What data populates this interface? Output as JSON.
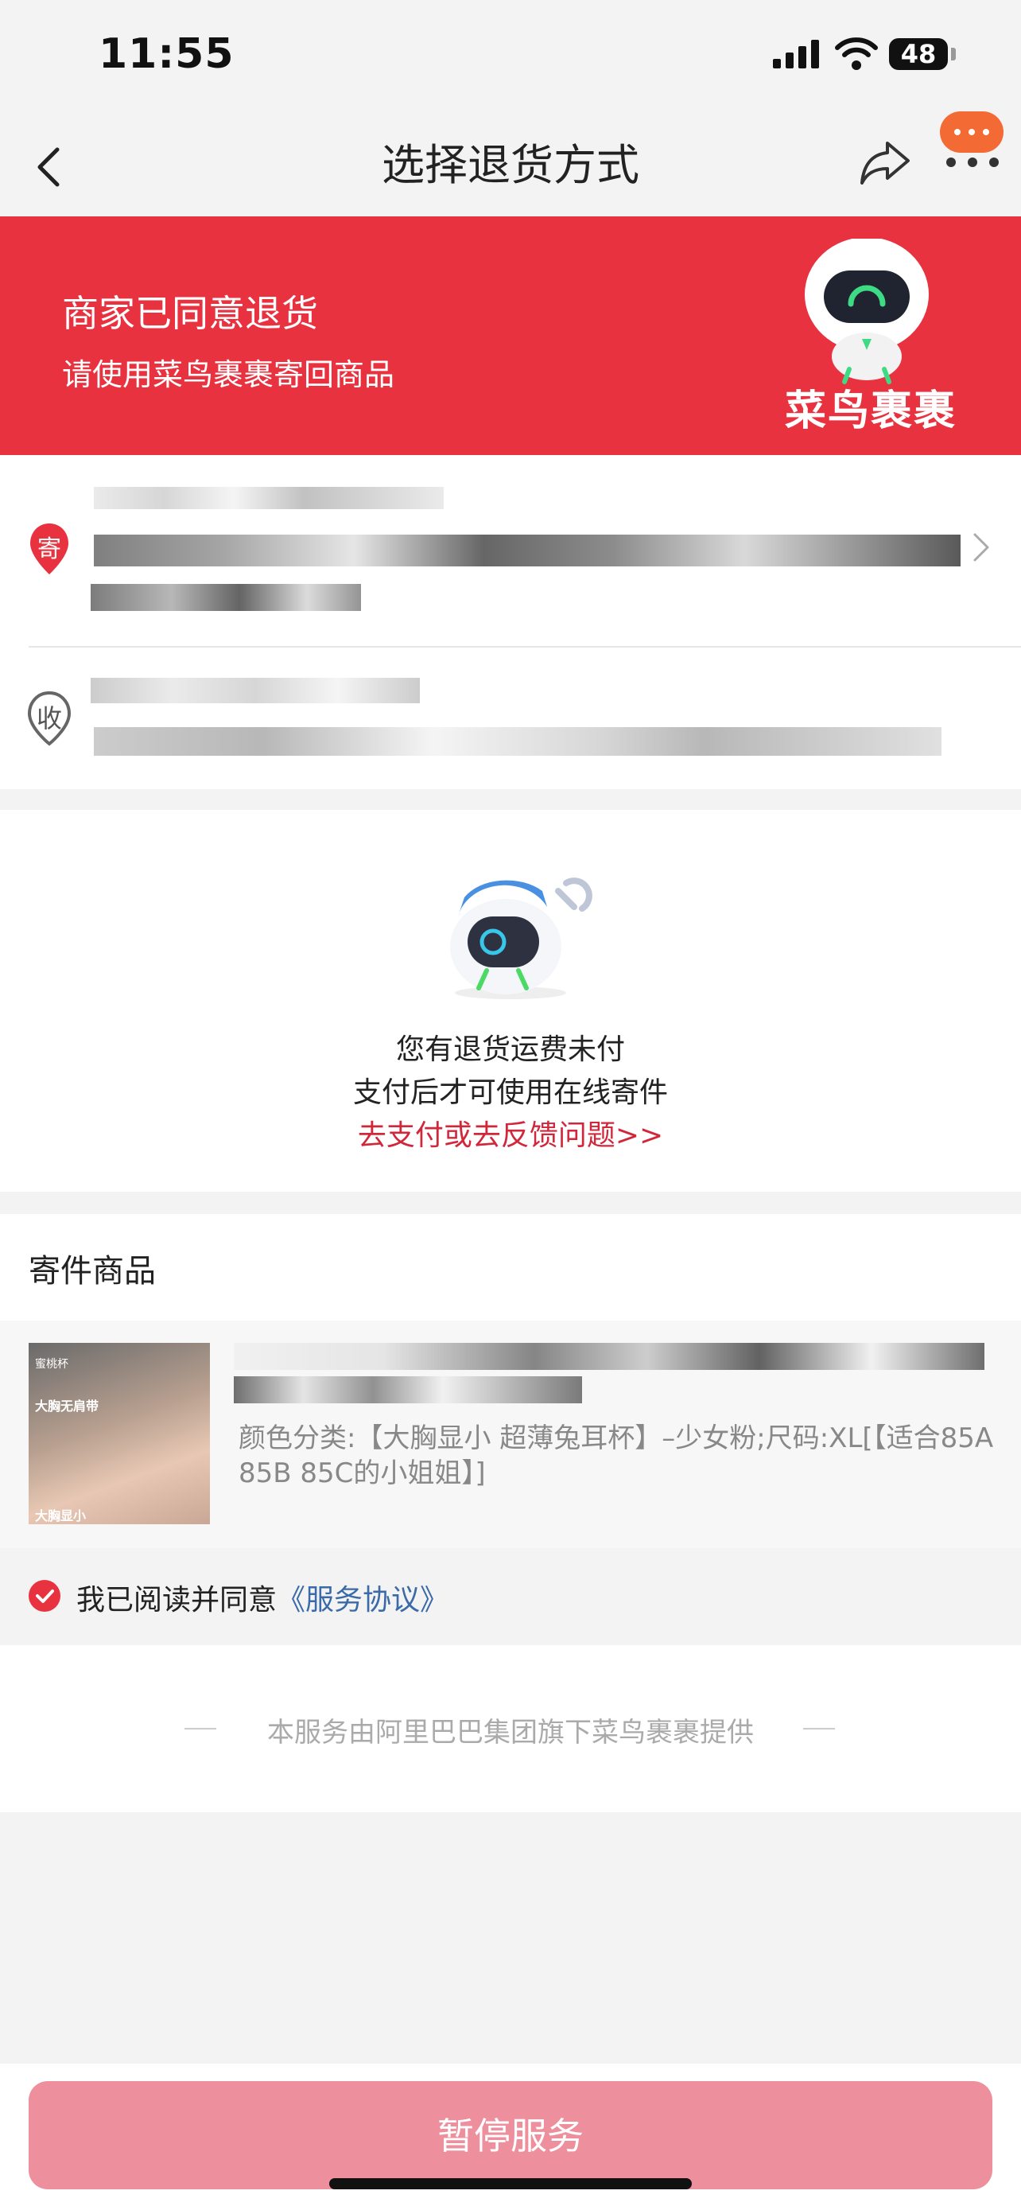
{
  "status_bar": {
    "time": "11:55",
    "battery": "48"
  },
  "nav": {
    "title": "选择退货方式"
  },
  "banner": {
    "title": "商家已同意退货",
    "subtitle": "请使用菜鸟裹裹寄回商品",
    "brand": "菜鸟裹裹"
  },
  "address": {
    "sender_tag": "寄",
    "receiver_tag": "收"
  },
  "notice": {
    "line1": "您有退货运费未付",
    "line2": "支付后才可使用在线寄件",
    "link": "去支付或去反馈问题>>"
  },
  "goods": {
    "section_title": "寄件商品",
    "thumb_text1": "蜜桃杯",
    "thumb_text2": "大胸无肩带",
    "thumb_text3": "大胸显小",
    "sku": "颜色分类:【大胸显小 超薄兔耳杯】–少女粉;尺码:XL[【适合85A 85B 85C的小姐姐】]"
  },
  "agreement": {
    "prefix": "我已阅读并同意",
    "link": "《服务协议》"
  },
  "footer": {
    "text": "本服务由阿里巴巴集团旗下菜鸟裹裹提供"
  },
  "bottom": {
    "button": "暂停服务"
  },
  "colors": {
    "brand_red": "#e8323f",
    "link_red": "#d2273a",
    "button_pink": "#ee8f9e",
    "link_blue": "#3b6aa8"
  }
}
